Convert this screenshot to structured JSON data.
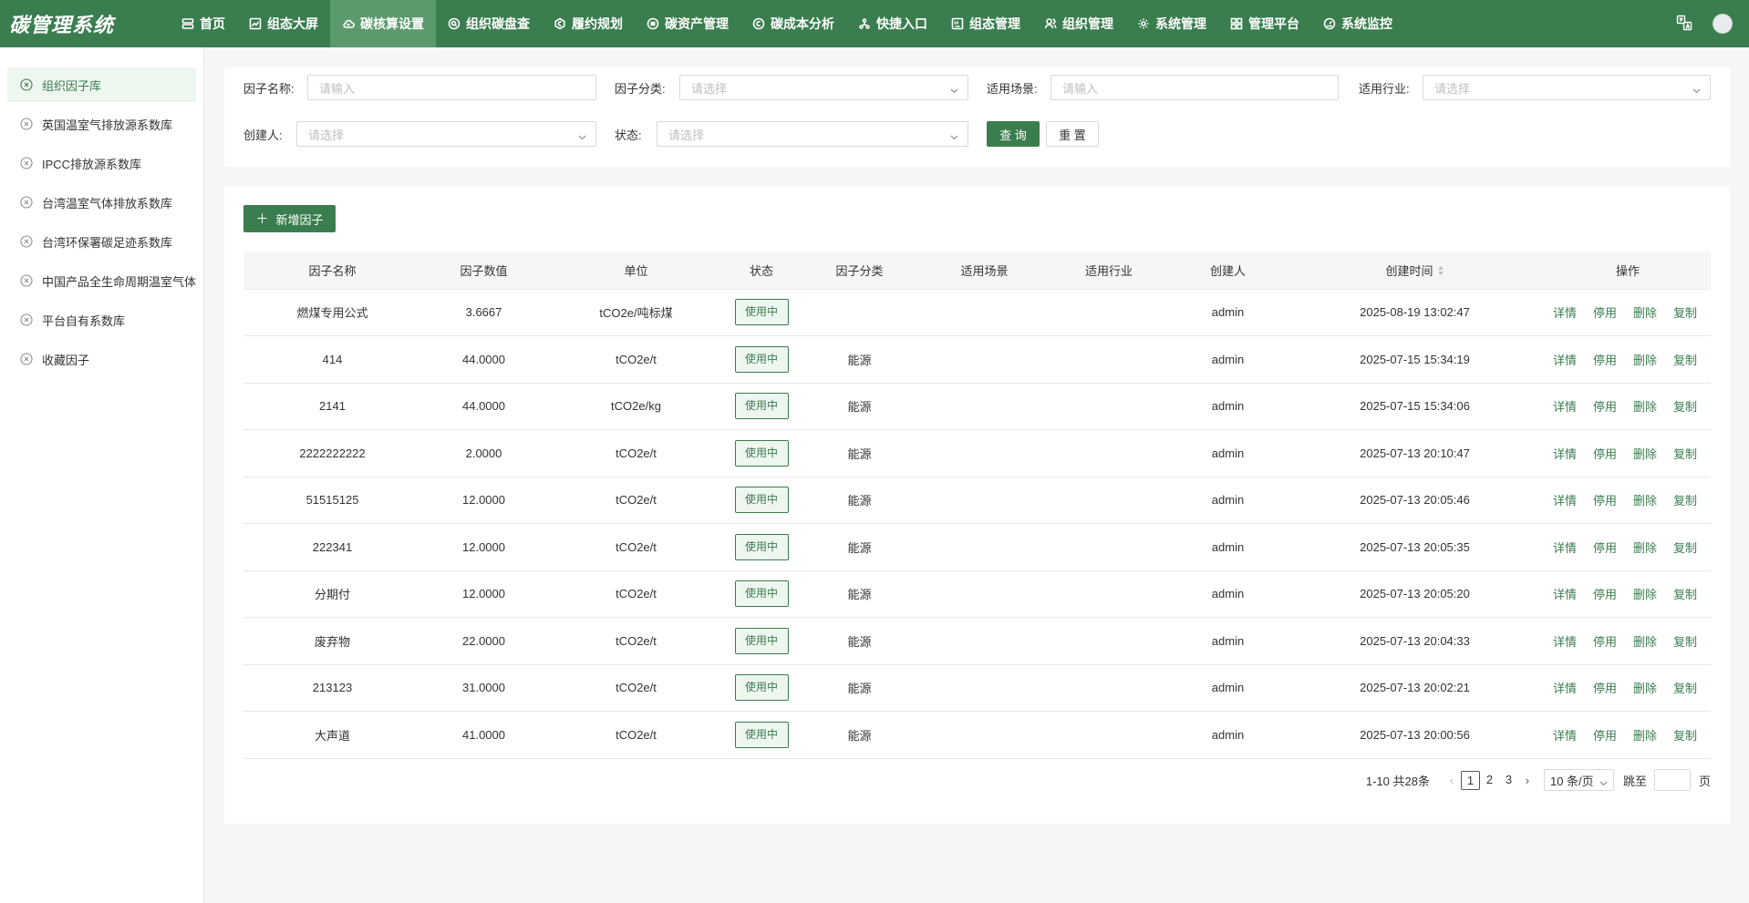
{
  "app": {
    "title": "碳管理系统"
  },
  "nav": [
    {
      "label": "首页",
      "icon": "server-icon",
      "active": false
    },
    {
      "label": "组态大屏",
      "icon": "chart-icon",
      "active": false
    },
    {
      "label": "碳核算设置",
      "icon": "cloud-icon",
      "active": true
    },
    {
      "label": "组织碳盘查",
      "icon": "search-circle-icon",
      "active": false
    },
    {
      "label": "履约规划",
      "icon": "coin-icon",
      "active": false
    },
    {
      "label": "碳资产管理",
      "icon": "database-icon",
      "active": false
    },
    {
      "label": "碳成本分析",
      "icon": "copyright-icon",
      "active": false
    },
    {
      "label": "快捷入口",
      "icon": "cluster-icon",
      "active": false
    },
    {
      "label": "组态管理",
      "icon": "layout-icon",
      "active": false
    },
    {
      "label": "组织管理",
      "icon": "users-icon",
      "active": false
    },
    {
      "label": "系统管理",
      "icon": "gear-icon",
      "active": false
    },
    {
      "label": "管理平台",
      "icon": "grid-icon",
      "active": false
    },
    {
      "label": "系统监控",
      "icon": "gauge-icon",
      "active": false
    }
  ],
  "sidebar": {
    "items": [
      {
        "label": "组织因子库",
        "active": true
      },
      {
        "label": "英国温室气排放源系数库",
        "active": false
      },
      {
        "label": "IPCC排放源系数库",
        "active": false
      },
      {
        "label": "台湾温室气体排放系数库",
        "active": false
      },
      {
        "label": "台湾环保署碳足迹系数库",
        "active": false
      },
      {
        "label": "中国产品全生命周期温室气体排放系数库",
        "active": false
      },
      {
        "label": "平台自有系数库",
        "active": false
      },
      {
        "label": "收藏因子",
        "active": false
      }
    ]
  },
  "filters": {
    "factor_name": {
      "label": "因子名称:",
      "placeholder": "请输入"
    },
    "factor_category": {
      "label": "因子分类:",
      "placeholder": "请选择"
    },
    "scenario": {
      "label": "适用场景:",
      "placeholder": "请输入"
    },
    "industry": {
      "label": "适用行业:",
      "placeholder": "请选择"
    },
    "creator": {
      "label": "创建人:",
      "placeholder": "请选择"
    },
    "status": {
      "label": "状态:",
      "placeholder": "请选择"
    },
    "search_button": "查 询",
    "reset_button": "重 置"
  },
  "toolbar": {
    "add_button": "新增因子"
  },
  "table": {
    "columns": [
      "因子名称",
      "因子数值",
      "单位",
      "状态",
      "因子分类",
      "适用场景",
      "适用行业",
      "创建人",
      "创建时间",
      "操作"
    ],
    "actions": [
      "详情",
      "停用",
      "删除",
      "复制"
    ],
    "rows": [
      {
        "name": "燃煤专用公式",
        "value": "3.6667",
        "unit": "tCO2e/吨标煤",
        "status": "使用中",
        "category": "",
        "scenario": "",
        "industry": "",
        "creator": "admin",
        "created": "2025-08-19 13:02:47"
      },
      {
        "name": "414",
        "value": "44.0000",
        "unit": "tCO2e/t",
        "status": "使用中",
        "category": "能源",
        "scenario": "",
        "industry": "",
        "creator": "admin",
        "created": "2025-07-15 15:34:19"
      },
      {
        "name": "2141",
        "value": "44.0000",
        "unit": "tCO2e/kg",
        "status": "使用中",
        "category": "能源",
        "scenario": "",
        "industry": "",
        "creator": "admin",
        "created": "2025-07-15 15:34:06"
      },
      {
        "name": "2222222222",
        "value": "2.0000",
        "unit": "tCO2e/t",
        "status": "使用中",
        "category": "能源",
        "scenario": "",
        "industry": "",
        "creator": "admin",
        "created": "2025-07-13 20:10:47"
      },
      {
        "name": "51515125",
        "value": "12.0000",
        "unit": "tCO2e/t",
        "status": "使用中",
        "category": "能源",
        "scenario": "",
        "industry": "",
        "creator": "admin",
        "created": "2025-07-13 20:05:46"
      },
      {
        "name": "222341",
        "value": "12.0000",
        "unit": "tCO2e/t",
        "status": "使用中",
        "category": "能源",
        "scenario": "",
        "industry": "",
        "creator": "admin",
        "created": "2025-07-13 20:05:35"
      },
      {
        "name": "分期付",
        "value": "12.0000",
        "unit": "tCO2e/t",
        "status": "使用中",
        "category": "能源",
        "scenario": "",
        "industry": "",
        "creator": "admin",
        "created": "2025-07-13 20:05:20"
      },
      {
        "name": "废弃物",
        "value": "22.0000",
        "unit": "tCO2e/t",
        "status": "使用中",
        "category": "能源",
        "scenario": "",
        "industry": "",
        "creator": "admin",
        "created": "2025-07-13 20:04:33"
      },
      {
        "name": "213123",
        "value": "31.0000",
        "unit": "tCO2e/t",
        "status": "使用中",
        "category": "能源",
        "scenario": "",
        "industry": "",
        "creator": "admin",
        "created": "2025-07-13 20:02:21"
      },
      {
        "name": "大声道",
        "value": "41.0000",
        "unit": "tCO2e/t",
        "status": "使用中",
        "category": "能源",
        "scenario": "",
        "industry": "",
        "creator": "admin",
        "created": "2025-07-13 20:00:56"
      }
    ]
  },
  "pagination": {
    "total_text": "1-10 共28条",
    "pages": [
      "1",
      "2",
      "3"
    ],
    "current": "1",
    "page_size": "10 条/页",
    "jump_label": "跳至",
    "page_suffix": "页"
  },
  "colors": {
    "brand": "#3a7d4e",
    "nav_active": "#5a9a6c"
  }
}
